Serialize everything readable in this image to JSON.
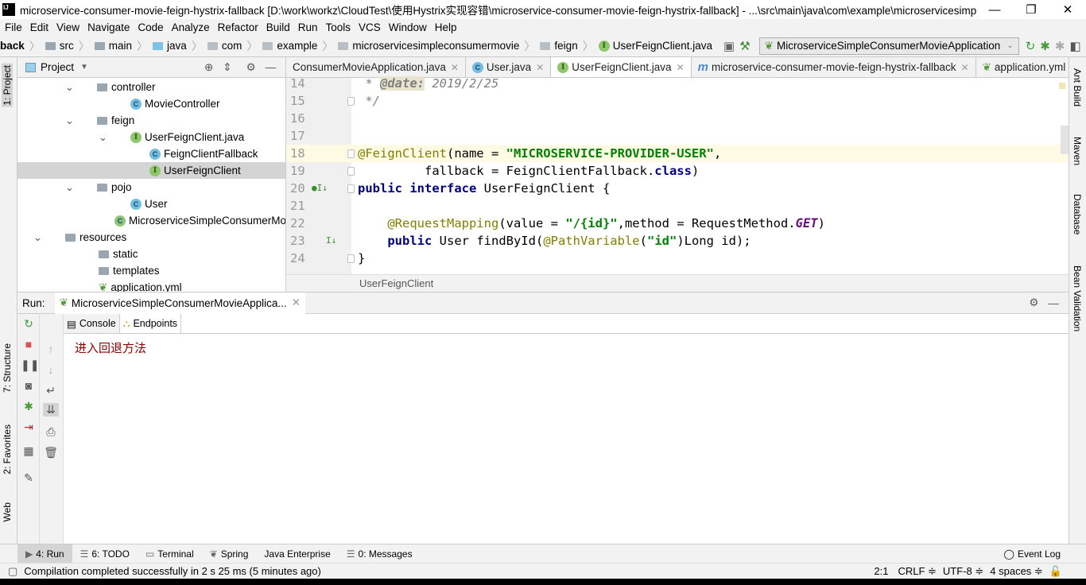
{
  "window": {
    "title": "microservice-consumer-movie-feign-hystrix-fallback [D:\\work\\workz\\CloudTest\\使用Hystrix实现容错\\microservice-consumer-movie-feign-hystrix-fallback] - ...\\src\\main\\java\\com\\example\\microservicesimple...",
    "logo": "IJ",
    "minimize": "—",
    "restore": "❐",
    "close": "✕"
  },
  "menu": [
    "File",
    "Edit",
    "View",
    "Navigate",
    "Code",
    "Analyze",
    "Refactor",
    "Build",
    "Run",
    "Tools",
    "VCS",
    "Window",
    "Help"
  ],
  "breadcrumb": [
    {
      "label": "back",
      "icon": "none"
    },
    {
      "label": "src",
      "icon": "folder"
    },
    {
      "label": "main",
      "icon": "folder"
    },
    {
      "label": "java",
      "icon": "folder-blue"
    },
    {
      "label": "com",
      "icon": "package"
    },
    {
      "label": "example",
      "icon": "package"
    },
    {
      "label": "microservicesimpleconsumermovie",
      "icon": "package"
    },
    {
      "label": "feign",
      "icon": "package"
    },
    {
      "label": "UserFeignClient.java",
      "icon": "interface"
    }
  ],
  "run_config": "MicroserviceSimpleConsumerMovieApplication",
  "left_stripe": [
    "1: Project",
    "7: Structure",
    "2: Favorites",
    "Web"
  ],
  "right_stripe": [
    "Ant Build",
    "Maven",
    "Database",
    "Bean Validation"
  ],
  "project": {
    "title": "Project",
    "tree": [
      {
        "label": "controller",
        "type": "folder",
        "expanded": true
      },
      {
        "label": "MovieController",
        "type": "class"
      },
      {
        "label": "feign",
        "type": "folder",
        "expanded": true
      },
      {
        "label": "UserFeignClient.java",
        "type": "interface",
        "expanded": true
      },
      {
        "label": "FeignClientFallback",
        "type": "class"
      },
      {
        "label": "UserFeignClient",
        "type": "interface",
        "selected": true
      },
      {
        "label": "pojo",
        "type": "folder",
        "expanded": true
      },
      {
        "label": "User",
        "type": "class"
      },
      {
        "label": "MicroserviceSimpleConsumerMovieApplication",
        "type": "spring-class"
      },
      {
        "label": "resources",
        "type": "folder",
        "expanded": true
      },
      {
        "label": "static",
        "type": "folder"
      },
      {
        "label": "templates",
        "type": "folder"
      },
      {
        "label": "application.yml",
        "type": "yml"
      }
    ]
  },
  "editor": {
    "tabs": [
      {
        "label": "ConsumerMovieApplication.java",
        "icon": "none"
      },
      {
        "label": "User.java",
        "icon": "class"
      },
      {
        "label": "UserFeignClient.java",
        "icon": "interface",
        "active": true
      },
      {
        "label": "microservice-consumer-movie-feign-hystrix-fallback",
        "icon": "maven"
      },
      {
        "label": "application.yml",
        "icon": "spring"
      }
    ],
    "tab_overflow": "▾≡1",
    "lines": [
      {
        "n": "14",
        "tokens": [
          [
            " * ",
            "cmt"
          ],
          [
            "@date:",
            "tag"
          ],
          [
            " 2019/2/25",
            "cmt"
          ]
        ]
      },
      {
        "n": "15",
        "tokens": [
          [
            " */",
            "cmt"
          ]
        ]
      },
      {
        "n": "16",
        "tokens": []
      },
      {
        "n": "17",
        "tokens": []
      },
      {
        "n": "18",
        "current": true,
        "tokens": [
          [
            "@FeignClient",
            "ann"
          ],
          [
            "(name = ",
            ""
          ],
          [
            "\"MICROSERVICE-PROVIDER-USER\"",
            "str"
          ],
          [
            ",",
            ""
          ]
        ]
      },
      {
        "n": "19",
        "tokens": [
          [
            "         fallback = FeignClientFallback.",
            ""
          ],
          [
            "class",
            "kw"
          ],
          [
            ")",
            ""
          ]
        ]
      },
      {
        "n": "20",
        "tokens": [
          [
            "public interface",
            "kw"
          ],
          [
            " UserFeignClient {",
            ""
          ]
        ]
      },
      {
        "n": "21",
        "tokens": []
      },
      {
        "n": "22",
        "tokens": [
          [
            "    ",
            ""
          ],
          [
            "@RequestMapping",
            "ann"
          ],
          [
            "(value = ",
            ""
          ],
          [
            "\"/{id}\"",
            "str"
          ],
          [
            ",method = RequestMethod.",
            ""
          ],
          [
            "GET",
            "cst"
          ],
          [
            ")",
            ""
          ]
        ]
      },
      {
        "n": "23",
        "tokens": [
          [
            "    ",
            ""
          ],
          [
            "public",
            "kw"
          ],
          [
            " User findById(",
            ""
          ],
          [
            "@PathVariable",
            "ann"
          ],
          [
            "(",
            ""
          ],
          [
            "\"id\"",
            "str"
          ],
          [
            ")Long id);",
            ""
          ]
        ]
      },
      {
        "n": "24",
        "tokens": [
          [
            "}",
            ""
          ]
        ]
      }
    ],
    "breadcrumb": "UserFeignClient"
  },
  "run": {
    "label": "Run:",
    "config_tab": "MicroserviceSimpleConsumerMovieApplica...",
    "tabs": [
      "Console",
      "Endpoints"
    ],
    "output": "进入回退方法"
  },
  "bottom_tools": [
    {
      "label": "4: Run",
      "active": true
    },
    {
      "label": "6: TODO"
    },
    {
      "label": "Terminal"
    },
    {
      "label": "Spring"
    },
    {
      "label": "Java Enterprise"
    },
    {
      "label": "0: Messages"
    }
  ],
  "event_log": "Event Log",
  "status": {
    "message": "Compilation completed successfully in 2 s 25 ms (5 minutes ago)",
    "position": "2:1",
    "line_sep": "CRLF ≑",
    "encoding": "UTF-8 ≑",
    "indent": "4 spaces ≑"
  }
}
